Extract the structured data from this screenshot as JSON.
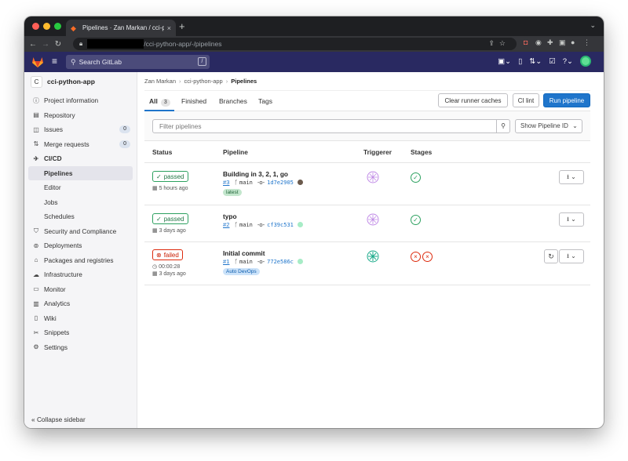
{
  "browser": {
    "tab_title": "Pipelines · Zan Markan / cci-py",
    "tab_close": "×",
    "new_tab": "+",
    "url_path": "/cci-python-app/-/pipelines"
  },
  "gitlab_header": {
    "search_placeholder": "Search GitLab",
    "search_shortcut": "/"
  },
  "sidebar": {
    "project_initial": "C",
    "project_name": "cci-python-app",
    "items": [
      {
        "label": "Project information",
        "icon": "info-icon"
      },
      {
        "label": "Repository",
        "icon": "doc-icon"
      },
      {
        "label": "Issues",
        "icon": "issues-icon",
        "count": "0"
      },
      {
        "label": "Merge requests",
        "icon": "merge-icon",
        "count": "0"
      },
      {
        "label": "CI/CD",
        "icon": "rocket-icon"
      }
    ],
    "cicd_sub": [
      "Pipelines",
      "Editor",
      "Jobs",
      "Schedules"
    ],
    "items2": [
      {
        "label": "Security and Compliance",
        "icon": "shield-icon"
      },
      {
        "label": "Deployments",
        "icon": "deploy-icon"
      },
      {
        "label": "Packages and registries",
        "icon": "package-icon"
      },
      {
        "label": "Infrastructure",
        "icon": "cloud-icon"
      },
      {
        "label": "Monitor",
        "icon": "monitor-icon"
      },
      {
        "label": "Analytics",
        "icon": "chart-icon"
      },
      {
        "label": "Wiki",
        "icon": "book-icon"
      },
      {
        "label": "Snippets",
        "icon": "scissors-icon"
      },
      {
        "label": "Settings",
        "icon": "gear-icon"
      }
    ],
    "collapse_label": "Collapse sidebar"
  },
  "breadcrumb": {
    "user": "Zan Markan",
    "project": "cci-python-app",
    "current": "Pipelines"
  },
  "tabs": {
    "all": "All",
    "all_count": "3",
    "finished": "Finished",
    "branches": "Branches",
    "tags": "Tags"
  },
  "actions": {
    "clear_cache": "Clear runner caches",
    "ci_lint": "CI lint",
    "run_pipeline": "Run pipeline"
  },
  "filter": {
    "placeholder": "Filter pipelines",
    "show_id": "Show Pipeline ID"
  },
  "columns": {
    "status": "Status",
    "pipeline": "Pipeline",
    "triggerer": "Triggerer",
    "stages": "Stages"
  },
  "pipelines": [
    {
      "status": "passed",
      "time": "5 hours ago",
      "duration": "",
      "title": "Building in 3, 2, 1, go",
      "id": "#3",
      "branch": "main",
      "sha": "1d7e2905",
      "tag": "latest"
    },
    {
      "status": "passed",
      "time": "3 days ago",
      "duration": "",
      "title": "typo",
      "id": "#2",
      "branch": "main",
      "sha": "cf39c531",
      "tag": ""
    },
    {
      "status": "failed",
      "time": "3 days ago",
      "duration": "00:00:28",
      "title": "Initial commit",
      "id": "#1",
      "branch": "main",
      "sha": "772e586c",
      "tag": "Auto DevOps"
    }
  ],
  "colors": {
    "gitlab_nav": "#292961",
    "primary": "#1f75cb",
    "success": "#2da160",
    "danger": "#dd2b0e"
  }
}
